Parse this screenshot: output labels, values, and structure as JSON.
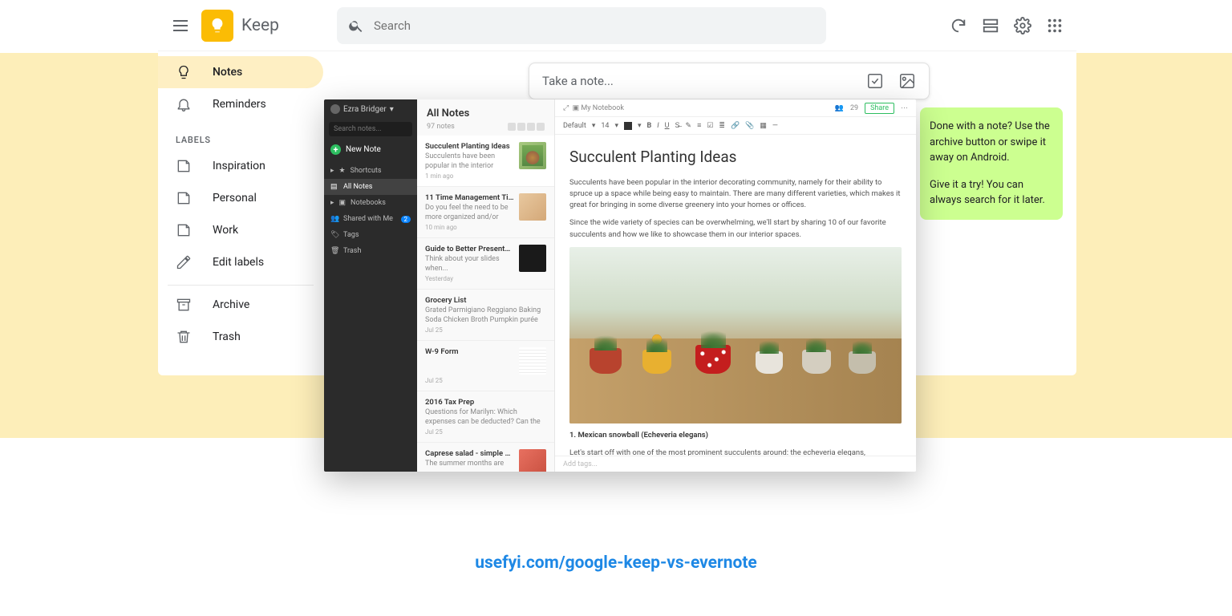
{
  "caption": "usefyi.com/google-keep-vs-evernote",
  "keep": {
    "appName": "Keep",
    "search": {
      "placeholder": "Search"
    },
    "sidebar": {
      "items": [
        {
          "label": "Notes"
        },
        {
          "label": "Reminders"
        }
      ],
      "labelsHeader": "LABELS",
      "labels": [
        {
          "label": "Inspiration"
        },
        {
          "label": "Personal"
        },
        {
          "label": "Work"
        },
        {
          "label": "Edit labels"
        }
      ],
      "bottom": [
        {
          "label": "Archive"
        },
        {
          "label": "Trash"
        }
      ]
    },
    "takeNote": "Take a note...",
    "greenNote": {
      "p1": "Done with a note? Use the archive button or swipe it away on Android.",
      "p2": "Give it a try! You can always search for it later."
    }
  },
  "evernote": {
    "user": "Ezra Bridger",
    "searchPlaceholder": "Search notes...",
    "newNote": "New Note",
    "nav": [
      {
        "label": "Shortcuts"
      },
      {
        "label": "All Notes",
        "active": true
      },
      {
        "label": "Notebooks"
      },
      {
        "label": "Shared with Me",
        "badge": "2"
      },
      {
        "label": "Tags"
      },
      {
        "label": "Trash"
      }
    ],
    "list": {
      "title": "All Notes",
      "count": "97 notes",
      "items": [
        {
          "title": "Succulent Planting Ideas",
          "snippet": "Succulents have been popular in the interior decorating co...",
          "date": "1 min ago",
          "thumb": 1,
          "sel": true
        },
        {
          "title": "11 Time Management Tips",
          "snippet": "Do you feel the need to be more organized and/or more...",
          "date": "10 min ago",
          "thumb": 2
        },
        {
          "title": "Guide to Better Presentations for your Business",
          "snippet": "Think about your slides when...",
          "date": "Yesterday",
          "thumb": 3
        },
        {
          "title": "Grocery List",
          "snippet": "Grated Parmigiano Reggiano Baking Soda Chicken Broth Pumpkin purée Espresso Po...",
          "date": "Jul 25"
        },
        {
          "title": "W-9 Form",
          "snippet": "",
          "date": "Jul 25",
          "thumb": 4
        },
        {
          "title": "2016 Tax Prep",
          "snippet": "Questions for Marilyn: Which expenses can be deducted? Can the cost of the NAD...",
          "date": "Jul 25"
        },
        {
          "title": "Caprese salad - simple and",
          "snippet": "The summer months are",
          "date": "",
          "thumb": 5
        }
      ]
    },
    "editor": {
      "notebook": "My Notebook",
      "members": "29",
      "share": "Share",
      "fontLabel": "Default",
      "fontSize": "14",
      "title": "Succulent Planting Ideas",
      "p1": "Succulents have been popular in the interior decorating community, namely for their ability to spruce up a space while being easy to maintain. There are many different varieties, which makes it great for bringing in some diverse greenery into your homes or offices.",
      "p2": "Since the wide variety of species can be overwhelming, we'll start by sharing 10 of our favorite succulents and how we like to showcase them in our interior spaces.",
      "sub1": "1. Mexican snowball (Echeveria elegans)",
      "sub1text": "Let's start off with one of the most prominent succulents around: the echeveria elegans, affectionately",
      "tagsPlaceholder": "Add tags..."
    }
  }
}
